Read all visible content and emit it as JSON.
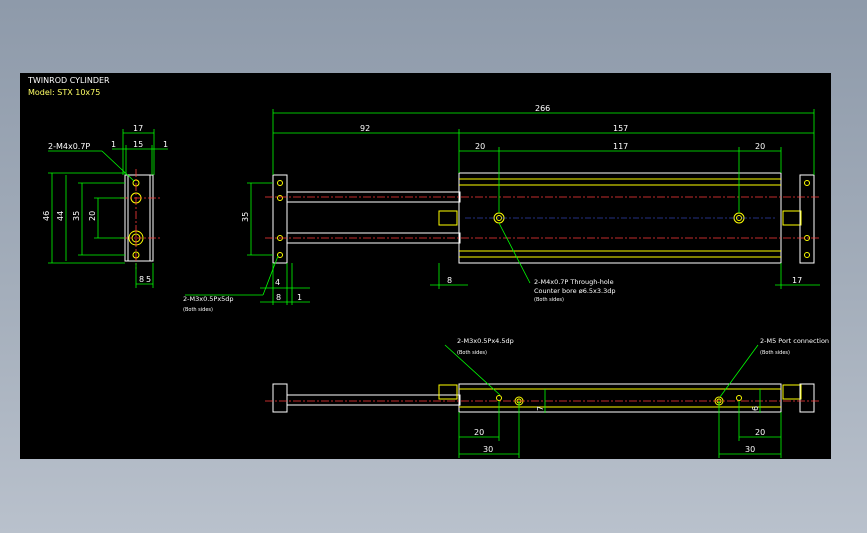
{
  "title": "TWINROD CYLINDER",
  "model": "Model: STX 10x75",
  "side_view": {
    "callout_label": "2-M4x0.7P",
    "dim_top_17": "17",
    "dim_1_left": "1",
    "dim_15": "15",
    "dim_1_right": "1",
    "dim_46": "46",
    "dim_44": "44",
    "dim_35": "35",
    "dim_20": "20",
    "dim_8": "8",
    "dim_5": "5"
  },
  "front_view": {
    "dim_266": "266",
    "dim_92": "92",
    "dim_157": "157",
    "dim_20_left": "20",
    "dim_117": "117",
    "dim_20_right": "20",
    "dim_35": "35",
    "dim_4": "4",
    "dim_8_left": "8",
    "dim_1": "1",
    "dim_8_mid": "8",
    "dim_17": "17",
    "callout_m3": "2-M3x0.5Px5dp",
    "callout_m3_sub": "(Both sides)",
    "callout_m4": "2-M4x0.7P Through-hole",
    "callout_m4_cb": "Counter bore ø6.5x3.3dp",
    "callout_m4_sub": "(Both sides)"
  },
  "bottom_view": {
    "callout_m3": "2-M3x0.5Px4.5dp",
    "callout_m3_sub": "(Both sides)",
    "callout_m5": "2-M5 Port connection",
    "callout_m5_sub": "(Both sides)",
    "dim_7": "7",
    "dim_6": "6",
    "dim_20_left": "20",
    "dim_30_left": "30",
    "dim_20_right": "20",
    "dim_30_right": "30"
  }
}
